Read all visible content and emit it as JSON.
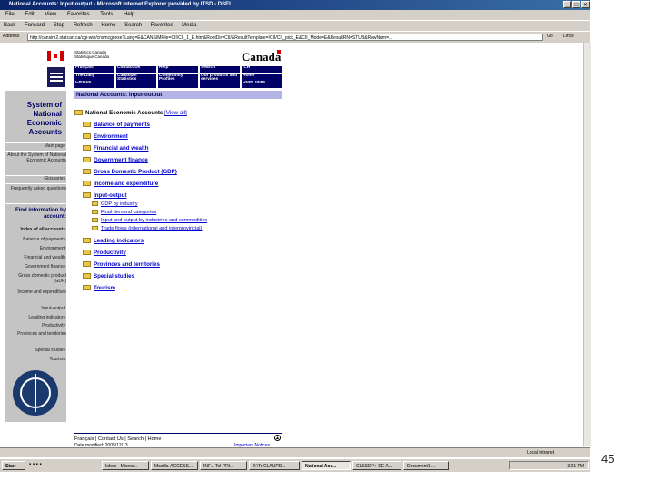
{
  "window": {
    "title": "National Accounts: Input-output - Microsoft Internet Explorer provided by ITSD - DSEI"
  },
  "menubar": [
    "File",
    "Edit",
    "View",
    "Favorites",
    "Tools",
    "Help"
  ],
  "toolbar": [
    "Back",
    "Forward",
    "Stop",
    "Refresh",
    "Home",
    "Search",
    "Favorites",
    "Media"
  ],
  "address": {
    "label": "Address",
    "value": "http://cansim2.statcan.ca/cgi-win/cnsmcgi.exe?Lang=E&CANSIMFile=CII\\CII_1_E.htm&RootDir=CII/&ResultTemplate=/CII/CII_pick_E&CII_Mode=E&ResultRN=STUB&RowNum=...",
    "go": "Go",
    "links": "Links"
  },
  "header": {
    "sc_en": "Statistics Canada",
    "sc_fr": "Statistique Canada",
    "canada_wordmark": "Canada",
    "nav": [
      [
        "Français",
        "Contact Us",
        "Help",
        "Search",
        "ICH"
      ],
      [
        "The Daily",
        "Canadian Statistics",
        "Community Profiles",
        "Our products and services",
        "Home"
      ],
      [
        "Census",
        "",
        "",
        "",
        "Other links"
      ]
    ],
    "banner": "National Accounts: Input-output"
  },
  "sidebar": {
    "title": "System of National Economic Accounts",
    "links": [
      "Main page",
      "About the System of National Economic Accounts",
      "Glossaries",
      "Frequently asked questions",
      "Find information by account:",
      "Index of all accounts",
      "Balance of payments",
      "Environment",
      "Financial and wealth",
      "Government finance",
      "Gross domestic product (GDP)",
      "Income and expenditure",
      "Input-output",
      "Leading indicators",
      "Productivity",
      "Provinces and territories",
      "Special studies",
      "Tourism"
    ]
  },
  "tree": {
    "root": "National Economic Accounts",
    "view_all": "[View all]",
    "items": [
      "Balance of payments",
      "Environment",
      "Financial and wealth",
      "Government finance",
      "Gross Domestic Product (GDP)",
      "Income and expenditure",
      "Input-output"
    ],
    "sub_items": [
      "GDP by industry",
      "Final demand categories",
      "Input and output by industries and commodities",
      "Trade flows (international and interprovincial)"
    ],
    "items_after": [
      "Leading indicators",
      "Productivity",
      "Provinces and territories",
      "Special studies",
      "Tourism"
    ]
  },
  "footer": {
    "links": "Français | Contact Us | Search | Home",
    "date": "Date modified: 2005/12/13",
    "notices": "Important Notices"
  },
  "statusbar": {
    "zone": "Local intranet"
  },
  "taskbar": {
    "start": "Start",
    "tasks": [
      "Inbox - Micros...",
      "Mozilla-ACCESS...",
      "INF... Tel PRI...",
      "Z:\\Tr-CLAUPD...",
      "National Acc...",
      "CLSSDP+ DE A...",
      "Document1 ..."
    ],
    "clock": "3:21 PM"
  },
  "slide_number": "45"
}
